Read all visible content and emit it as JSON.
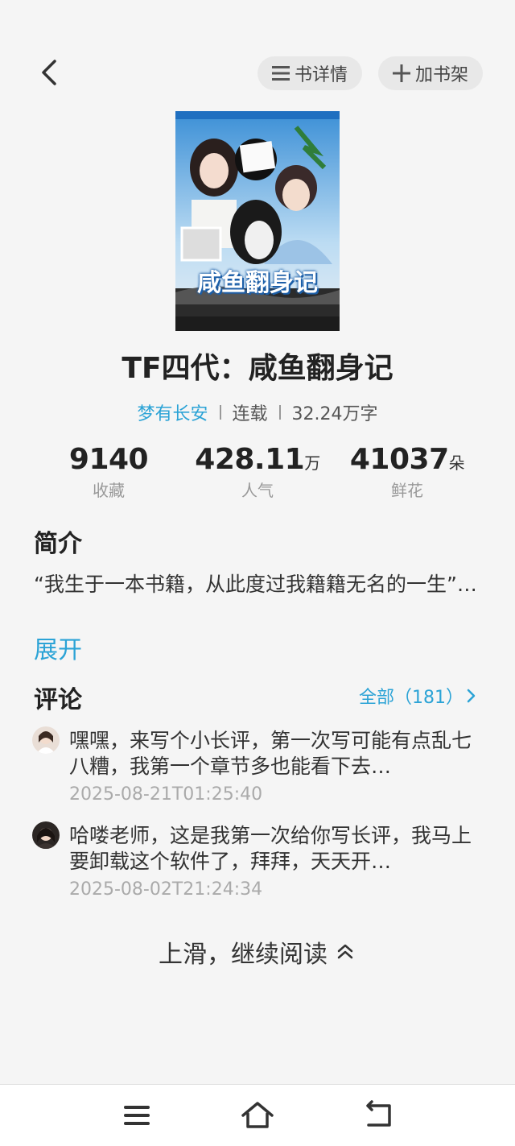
{
  "header": {
    "detail_label": "书详情",
    "shelf_label": "加书架"
  },
  "book": {
    "cover_title": "咸鱼翻身记",
    "title": "TF四代：咸鱼翻身记",
    "author": "梦有长安",
    "status": "连载",
    "word_count": "32.24万字"
  },
  "stats": [
    {
      "value": "9140",
      "unit": "",
      "label": "收藏"
    },
    {
      "value": "428.11",
      "unit": "万",
      "label": "人气"
    },
    {
      "value": "41037",
      "unit": "朵",
      "label": "鲜花"
    }
  ],
  "intro": {
    "heading": "简介",
    "text": "“我生于一本书籍，从此度过我籍籍无名的一生”…",
    "expand_label": "展开"
  },
  "comments": {
    "heading": "评论",
    "all_label": "全部（181）",
    "items": [
      {
        "text": "嘿嘿，来写个小长评，第一次写可能有点乱七八糟，我第一个章节多也能看下去…",
        "time": "2025-08-21T01:25:40"
      },
      {
        "text": "哈喽老师，这是我第一次给你写长评，我马上要卸载这个软件了，拜拜，天天开…",
        "time": "2025-08-02T21:24:34"
      }
    ]
  },
  "continue_label": "上滑，继续阅读",
  "colors": {
    "accent": "#2ba3d6",
    "background": "#f5f5f5"
  }
}
